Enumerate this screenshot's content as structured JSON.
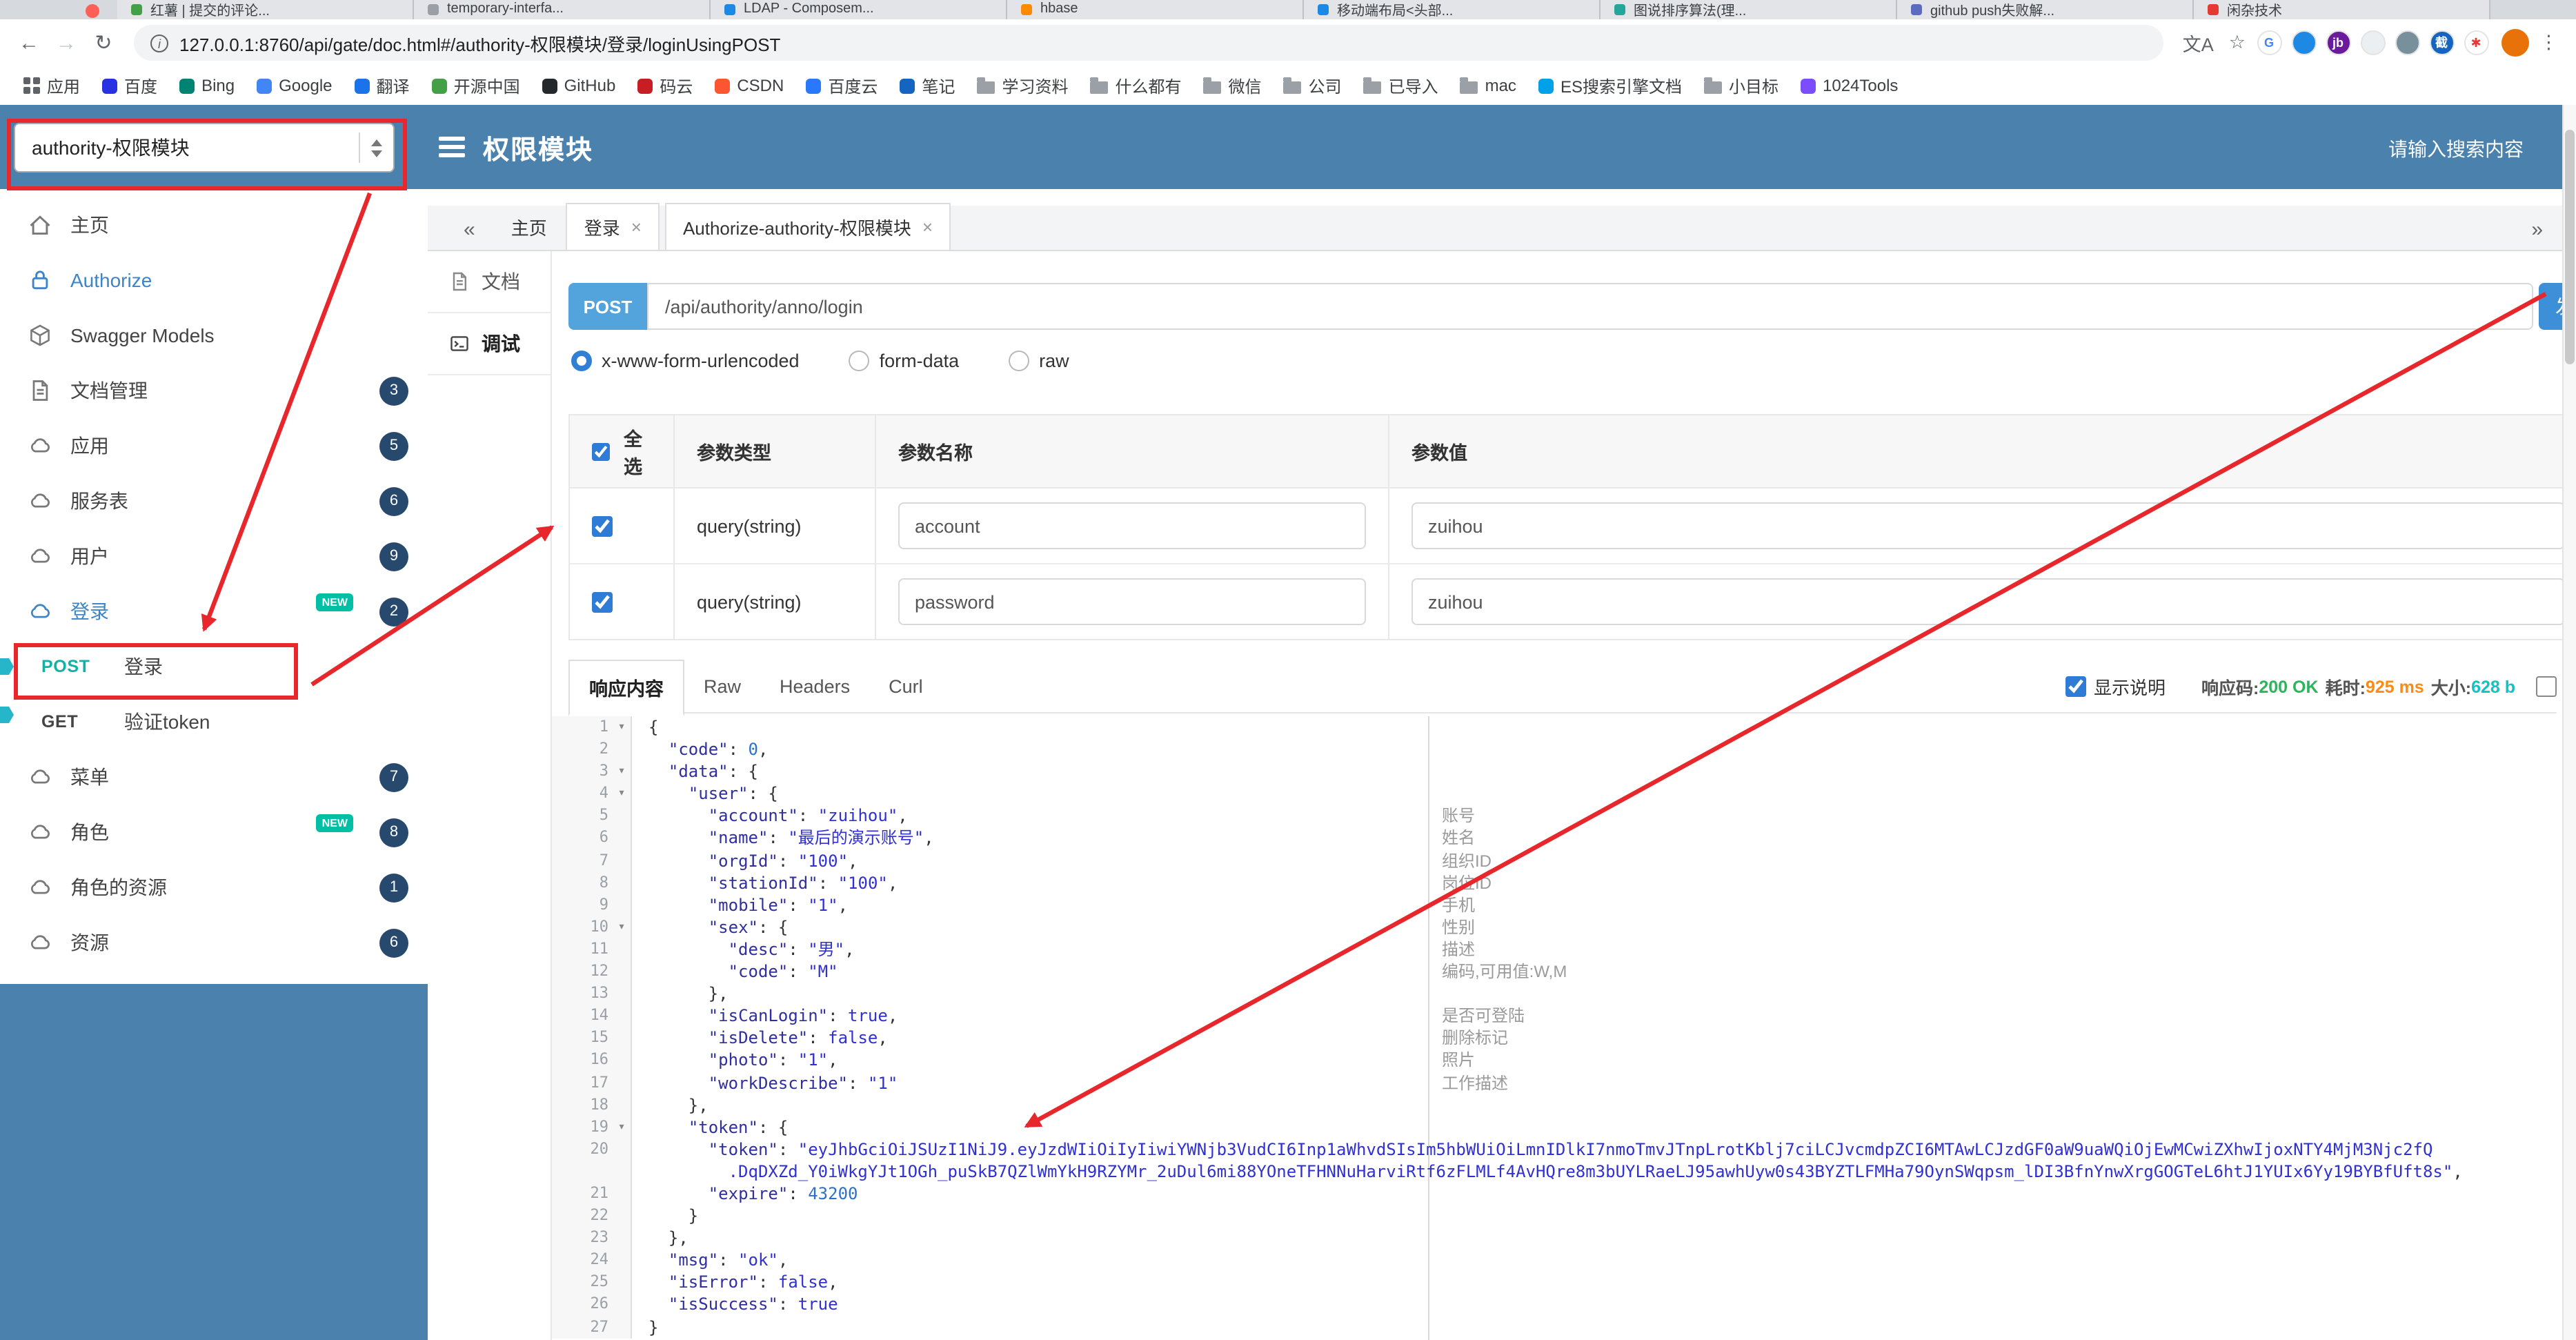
{
  "icons": {
    "back": "←",
    "forward": "→",
    "reload": "↻",
    "star": "☆",
    "overflow": "⋮",
    "translate": "文A",
    "chevrons_left": "«",
    "chevrons_right": "»",
    "close": "×",
    "info": "i",
    "fold": "▾"
  },
  "browser": {
    "tabs": [
      {
        "title": "红薯 | 提交的评论...",
        "color": "#43a047"
      },
      {
        "title": "temporary-interfa...",
        "color": "#9aa0a6"
      },
      {
        "title": "LDAP - Composem...",
        "color": "#1e88e5"
      },
      {
        "title": "hbase",
        "color": "#fb8c00"
      },
      {
        "title": "移动端布局<头部...",
        "color": "#1e88e5"
      },
      {
        "title": "图说排序算法(理...",
        "color": "#26a69a"
      },
      {
        "title": "github push失败解...",
        "color": "#5c6bc0"
      },
      {
        "title": "闲杂技术",
        "color": "#e53935"
      }
    ],
    "url": "127.0.0.1:8760/api/gate/doc.html#/authority-权限模块/登录/loginUsingPOST",
    "extensions": [
      {
        "glyph": "G",
        "bg": "#ffffff",
        "fg": "#4285f4"
      },
      {
        "glyph": "",
        "bg": "#1e88e5",
        "fg": "#ffffff"
      },
      {
        "glyph": "jb",
        "bg": "#6a1b9a",
        "fg": "#ffffff"
      },
      {
        "glyph": "",
        "bg": "#eceff1",
        "fg": "#555555"
      },
      {
        "glyph": "",
        "bg": "#78909c",
        "fg": "#ffffff"
      },
      {
        "glyph": "截",
        "bg": "#1565c0",
        "fg": "#ffffff"
      },
      {
        "glyph": "✱",
        "bg": "#ffffff",
        "fg": "#e53935"
      }
    ],
    "bookmarks": [
      {
        "label": "应用",
        "apps": true
      },
      {
        "label": "百度",
        "color": "#2932e1"
      },
      {
        "label": "Bing",
        "color": "#008373"
      },
      {
        "label": "Google",
        "color": "#4285f4"
      },
      {
        "label": "翻译",
        "color": "#1a73e8"
      },
      {
        "label": "开源中国",
        "color": "#43a047"
      },
      {
        "label": "GitHub",
        "color": "#24292e"
      },
      {
        "label": "码云",
        "color": "#c71d23"
      },
      {
        "label": "CSDN",
        "color": "#fc5531"
      },
      {
        "label": "百度云",
        "color": "#2979ff"
      },
      {
        "label": "笔记",
        "color": "#1565c0"
      },
      {
        "label": "学习资料",
        "folder": true
      },
      {
        "label": "什么都有",
        "folder": true
      },
      {
        "label": "微信",
        "folder": true
      },
      {
        "label": "公司",
        "folder": true
      },
      {
        "label": "已导入",
        "folder": true
      },
      {
        "label": "mac",
        "folder": true
      },
      {
        "label": "ES搜索引擎文档",
        "color": "#00a1e9"
      },
      {
        "label": "小目标",
        "folder": true
      },
      {
        "label": "1024Tools",
        "color": "#7c4dff"
      }
    ]
  },
  "header": {
    "module": "authority-权限模块",
    "title": "权限模块",
    "search_placeholder": "请输入搜索内容",
    "accent": "#4a81ad"
  },
  "sidebar": {
    "new_label": "NEW",
    "items": [
      {
        "label": "主页"
      },
      {
        "label": "Authorize"
      },
      {
        "label": "Swagger Models"
      },
      {
        "label": "文档管理",
        "badge": "3"
      },
      {
        "label": "应用",
        "badge": "5"
      },
      {
        "label": "服务表",
        "badge": "6"
      },
      {
        "label": "用户",
        "badge": "9"
      },
      {
        "label": "登录",
        "badge": "2",
        "new": true
      },
      {
        "method": "POST",
        "label": "登录"
      },
      {
        "method": "GET",
        "label": "验证token"
      },
      {
        "label": "菜单",
        "badge": "7"
      },
      {
        "label": "角色",
        "badge": "8",
        "new": true
      },
      {
        "label": "角色的资源",
        "badge": "1"
      },
      {
        "label": "资源",
        "badge": "6"
      }
    ]
  },
  "content": {
    "doc_tabs": [
      {
        "label": "主页"
      },
      {
        "label": "登录"
      },
      {
        "label": "Authorize-authority-权限模块"
      }
    ],
    "mini": {
      "doc": "文档",
      "debug": "调试"
    }
  },
  "request": {
    "method": "POST",
    "url": "/api/authority/anno/login",
    "send_label": "发送",
    "content_types": [
      "x-www-form-urlencoded",
      "form-data",
      "raw"
    ],
    "selected_content_type": "x-www-form-urlencoded"
  },
  "params": {
    "headers": [
      "全选",
      "参数类型",
      "参数名称",
      "参数值"
    ],
    "rows": [
      {
        "type": "query(string)",
        "name": "account",
        "value": "zuihou",
        "checked": true
      },
      {
        "type": "query(string)",
        "name": "password",
        "value": "zuihou",
        "checked": true
      }
    ]
  },
  "response": {
    "tabs": [
      "响应内容",
      "Raw",
      "Headers",
      "Curl"
    ],
    "active_tab": "响应内容",
    "show_desc": "显示说明",
    "meta": [
      {
        "label": "响应码:",
        "value": "200 OK",
        "style": "color:#2db55d"
      },
      {
        "label": "耗时:",
        "value": "925 ms",
        "style": "color:#fa8c16"
      },
      {
        "label": "大小:",
        "value": "628 b",
        "style": "color:#13c2c2"
      }
    ],
    "code": {
      "rows": [
        {
          "n": "1",
          "fold": true,
          "toks": [
            [
              "p",
              "{"
            ]
          ]
        },
        {
          "n": "2",
          "toks": [
            [
              "p",
              "  "
            ],
            [
              "k",
              "\"code\""
            ],
            [
              "p",
              ": "
            ],
            [
              "n",
              "0"
            ],
            [
              "p",
              ","
            ]
          ]
        },
        {
          "n": "3",
          "fold": true,
          "toks": [
            [
              "p",
              "  "
            ],
            [
              "k",
              "\"data\""
            ],
            [
              "p",
              ": {"
            ]
          ]
        },
        {
          "n": "4",
          "fold": true,
          "toks": [
            [
              "p",
              "    "
            ],
            [
              "k",
              "\"user\""
            ],
            [
              "p",
              ": {"
            ]
          ]
        },
        {
          "n": "5",
          "note": "账号",
          "toks": [
            [
              "p",
              "      "
            ],
            [
              "k",
              "\"account\""
            ],
            [
              "p",
              ": "
            ],
            [
              "s",
              "\"zuihou\""
            ],
            [
              "p",
              ","
            ]
          ]
        },
        {
          "n": "6",
          "note": "姓名",
          "toks": [
            [
              "p",
              "      "
            ],
            [
              "k",
              "\"name\""
            ],
            [
              "p",
              ": "
            ],
            [
              "s",
              "\"最后的演示账号\""
            ],
            [
              "p",
              ","
            ]
          ]
        },
        {
          "n": "7",
          "note": "组织ID",
          "toks": [
            [
              "p",
              "      "
            ],
            [
              "k",
              "\"orgId\""
            ],
            [
              "p",
              ": "
            ],
            [
              "s",
              "\"100\""
            ],
            [
              "p",
              ","
            ]
          ]
        },
        {
          "n": "8",
          "note": "岗位ID",
          "toks": [
            [
              "p",
              "      "
            ],
            [
              "k",
              "\"stationId\""
            ],
            [
              "p",
              ": "
            ],
            [
              "s",
              "\"100\""
            ],
            [
              "p",
              ","
            ]
          ]
        },
        {
          "n": "9",
          "note": "手机",
          "toks": [
            [
              "p",
              "      "
            ],
            [
              "k",
              "\"mobile\""
            ],
            [
              "p",
              ": "
            ],
            [
              "s",
              "\"1\""
            ],
            [
              "p",
              ","
            ]
          ]
        },
        {
          "n": "10",
          "fold": true,
          "note": "性别",
          "toks": [
            [
              "p",
              "      "
            ],
            [
              "k",
              "\"sex\""
            ],
            [
              "p",
              ": {"
            ]
          ]
        },
        {
          "n": "11",
          "note": "描述",
          "toks": [
            [
              "p",
              "        "
            ],
            [
              "k",
              "\"desc\""
            ],
            [
              "p",
              ": "
            ],
            [
              "s",
              "\"男\""
            ],
            [
              "p",
              ","
            ]
          ]
        },
        {
          "n": "12",
          "note": "编码,可用值:W,M",
          "toks": [
            [
              "p",
              "        "
            ],
            [
              "k",
              "\"code\""
            ],
            [
              "p",
              ": "
            ],
            [
              "s",
              "\"M\""
            ]
          ]
        },
        {
          "n": "13",
          "toks": [
            [
              "p",
              "      },"
            ]
          ]
        },
        {
          "n": "14",
          "note": "是否可登陆",
          "toks": [
            [
              "p",
              "      "
            ],
            [
              "k",
              "\"isCanLogin\""
            ],
            [
              "p",
              ": "
            ],
            [
              "b",
              "true"
            ],
            [
              "p",
              ","
            ]
          ]
        },
        {
          "n": "15",
          "note": "删除标记",
          "toks": [
            [
              "p",
              "      "
            ],
            [
              "k",
              "\"isDelete\""
            ],
            [
              "p",
              ": "
            ],
            [
              "b",
              "false"
            ],
            [
              "p",
              ","
            ]
          ]
        },
        {
          "n": "16",
          "note": "照片",
          "toks": [
            [
              "p",
              "      "
            ],
            [
              "k",
              "\"photo\""
            ],
            [
              "p",
              ": "
            ],
            [
              "s",
              "\"1\""
            ],
            [
              "p",
              ","
            ]
          ]
        },
        {
          "n": "17",
          "note": "工作描述",
          "toks": [
            [
              "p",
              "      "
            ],
            [
              "k",
              "\"workDescribe\""
            ],
            [
              "p",
              ": "
            ],
            [
              "s",
              "\"1\""
            ]
          ]
        },
        {
          "n": "18",
          "toks": [
            [
              "p",
              "    },"
            ]
          ]
        },
        {
          "n": "19",
          "fold": true,
          "toks": [
            [
              "p",
              "    "
            ],
            [
              "k",
              "\"token\""
            ],
            [
              "p",
              ": {"
            ]
          ]
        },
        {
          "n": "20",
          "toks": [
            [
              "p",
              "      "
            ],
            [
              "k",
              "\"token\""
            ],
            [
              "p",
              ": "
            ],
            [
              "s",
              "\"eyJhbGciOiJSUzI1NiJ9.eyJzdWIiOiIyIiwiYWNjb3VudCI6Inp1aWhvdSIsIm5hbWUiOiLmnIDlkI7nmoTmvJTnpLrotKblj7ciLCJvcmdpZCI6MTAwLCJzdGF0aW9uaWQiOjEwMCwiZXhwIjoxNTY4MjM3Njc2fQ"
            ]
          ]
        },
        {
          "n": "",
          "toks": [
            [
              "s",
              "        .DqDXZd_Y0iWkgYJt1OGh_puSkB7QZlWmYkH9RZYMr_2uDul6mi88YOneTFHNNuHarviRtf6zFLMLf4AvHQre8m3bUYLRaeLJ95awhUyw0s43BYZTLFMHa79OynSWqpsm_lDI3BfnYnwXrgGOGTeL6htJ1YUIx6Yy19BYBfUft8s\""
            ],
            [
              "p",
              ","
            ]
          ]
        },
        {
          "n": "21",
          "toks": [
            [
              "p",
              "      "
            ],
            [
              "k",
              "\"expire\""
            ],
            [
              "p",
              ": "
            ],
            [
              "n",
              "43200"
            ]
          ]
        },
        {
          "n": "22",
          "toks": [
            [
              "p",
              "    }"
            ]
          ]
        },
        {
          "n": "23",
          "toks": [
            [
              "p",
              "  },"
            ]
          ]
        },
        {
          "n": "24",
          "toks": [
            [
              "p",
              "  "
            ],
            [
              "k",
              "\"msg\""
            ],
            [
              "p",
              ": "
            ],
            [
              "s",
              "\"ok\""
            ],
            [
              "p",
              ","
            ]
          ]
        },
        {
          "n": "25",
          "toks": [
            [
              "p",
              "  "
            ],
            [
              "k",
              "\"isError\""
            ],
            [
              "p",
              ": "
            ],
            [
              "b",
              "false"
            ],
            [
              "p",
              ","
            ]
          ]
        },
        {
          "n": "26",
          "toks": [
            [
              "p",
              "  "
            ],
            [
              "k",
              "\"isSuccess\""
            ],
            [
              "p",
              ": "
            ],
            [
              "b",
              "true"
            ]
          ]
        },
        {
          "n": "27",
          "toks": [
            [
              "p",
              "}"
            ]
          ]
        }
      ]
    }
  }
}
